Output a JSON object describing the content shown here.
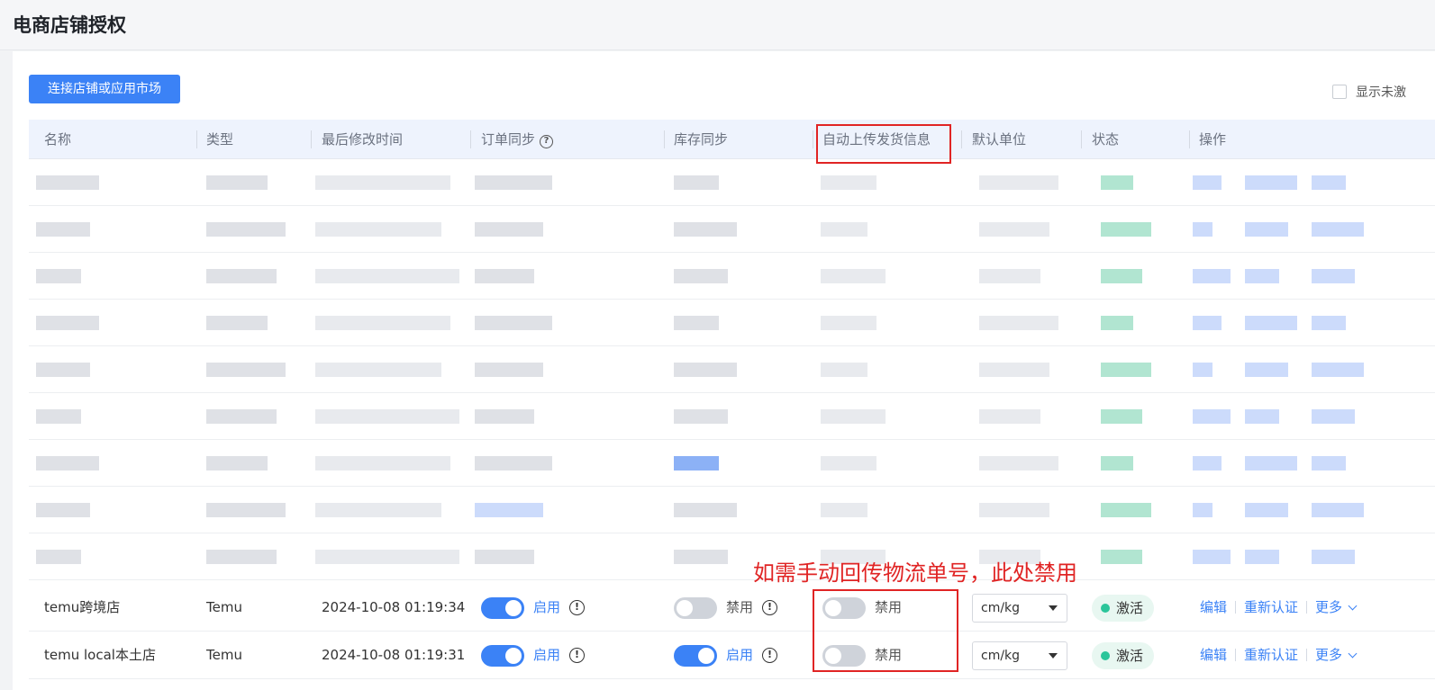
{
  "page": {
    "title": "电商店铺授权"
  },
  "toolbar": {
    "connect_label": "连接店铺或应用市场",
    "show_inactive_label": "显示未激"
  },
  "columns": [
    "名称",
    "类型",
    "最后修改时间",
    "订单同步",
    "库存同步",
    "自动上传发货信息",
    "默认单位",
    "状态",
    "操作"
  ],
  "rows": [
    {
      "name": "temu跨境店",
      "type": "Temu",
      "modified": "2024-10-08 01:19:34",
      "order_sync": "启用",
      "stock_sync": "禁用",
      "auto_upload": "禁用",
      "unit": "cm/kg",
      "status": "激活",
      "actions": {
        "edit": "编辑",
        "reauth": "重新认证",
        "more": "更多"
      }
    },
    {
      "name": "temu local本土店",
      "type": "Temu",
      "modified": "2024-10-08 01:19:31",
      "order_sync": "启用",
      "stock_sync": "启用",
      "auto_upload": "禁用",
      "unit": "cm/kg",
      "status": "激活",
      "actions": {
        "edit": "编辑",
        "reauth": "重新认证",
        "more": "更多"
      }
    }
  ],
  "annotation": {
    "text": "如需手动回传物流单号，此处禁用",
    "color": "#e02424"
  },
  "colors": {
    "primary": "#3b82f6",
    "status_active": "#2bc59a",
    "annotation": "#e02424"
  }
}
